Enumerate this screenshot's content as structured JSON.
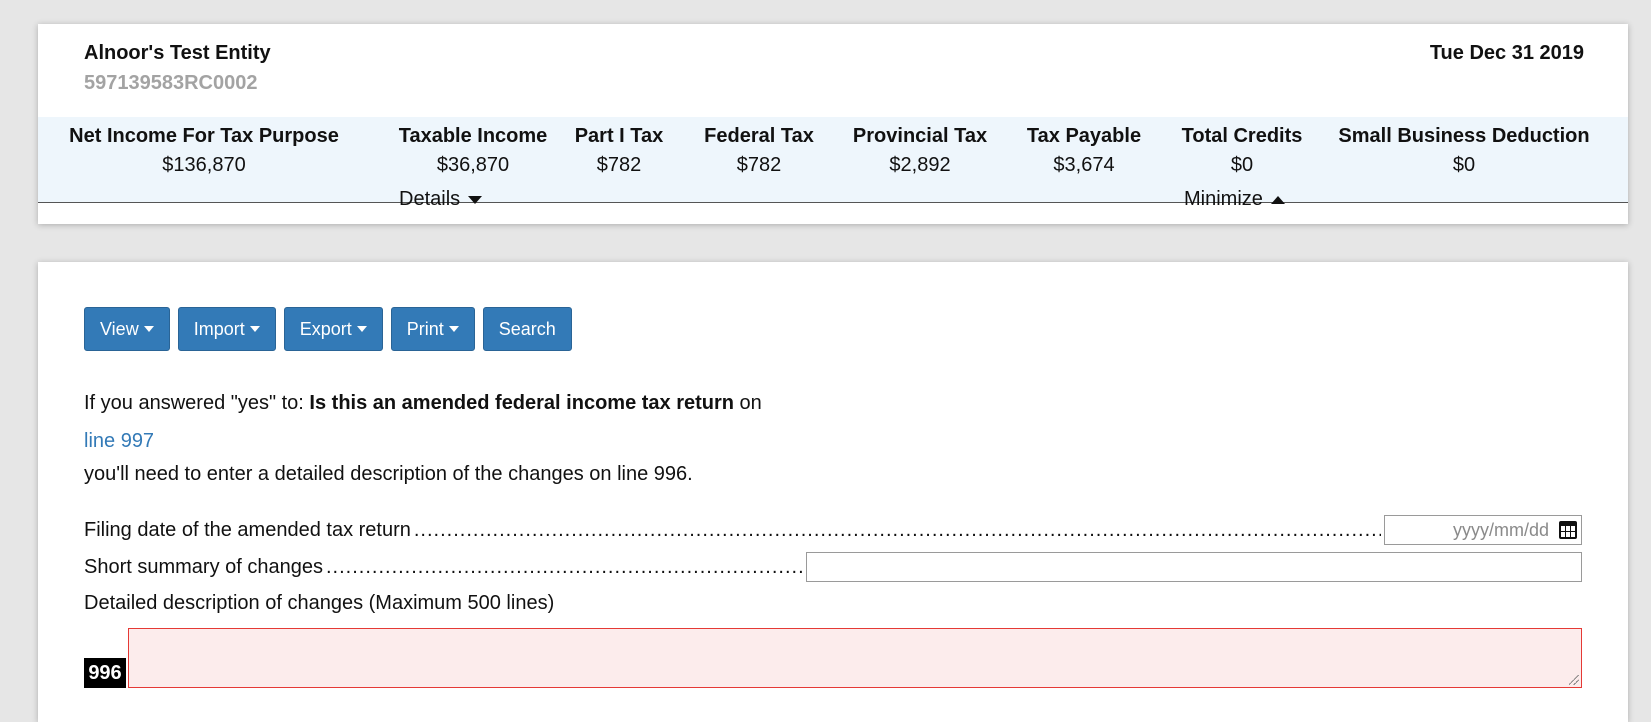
{
  "header": {
    "entity_name": "Alnoor's Test Entity",
    "entity_id": "597139583RC0002",
    "period_end": "Tue Dec 31 2019"
  },
  "metrics": [
    {
      "label": "Net Income For Tax Purpose",
      "value": "$136,870"
    },
    {
      "label": "Taxable Income",
      "value": "$36,870"
    },
    {
      "label": "Part I Tax",
      "value": "$782"
    },
    {
      "label": "Federal Tax",
      "value": "$782"
    },
    {
      "label": "Provincial Tax",
      "value": "$2,892"
    },
    {
      "label": "Tax Payable",
      "value": "$3,674"
    },
    {
      "label": "Total Credits",
      "value": "$0"
    },
    {
      "label": "Small Business Deduction",
      "value": "$0"
    }
  ],
  "toggles": {
    "details": "Details",
    "minimize": "Minimize"
  },
  "toolbar": {
    "view": "View",
    "import": "Import",
    "export": "Export",
    "print": "Print",
    "search": "Search"
  },
  "form": {
    "intro_prefix": "If you answered \"yes\" to: ",
    "intro_bold": "Is this an amended federal income tax return",
    "intro_suffix": " on",
    "line_link": "line 997",
    "note": "you'll need to enter a detailed description of the changes on line 996.",
    "filing_date_label": "Filing date of the amended tax return",
    "filing_date_placeholder": "yyyy/mm/dd",
    "summary_label": "Short summary of changes",
    "description_label": "Detailed description of changes (Maximum 500 lines)",
    "line_number": "996",
    "leader": "........................................................................................................................................................................................................"
  },
  "colors": {
    "primary": "#337ab7",
    "metrics_band": "#eef6fc",
    "error_border": "#e53935",
    "error_fill": "#fcecec"
  }
}
